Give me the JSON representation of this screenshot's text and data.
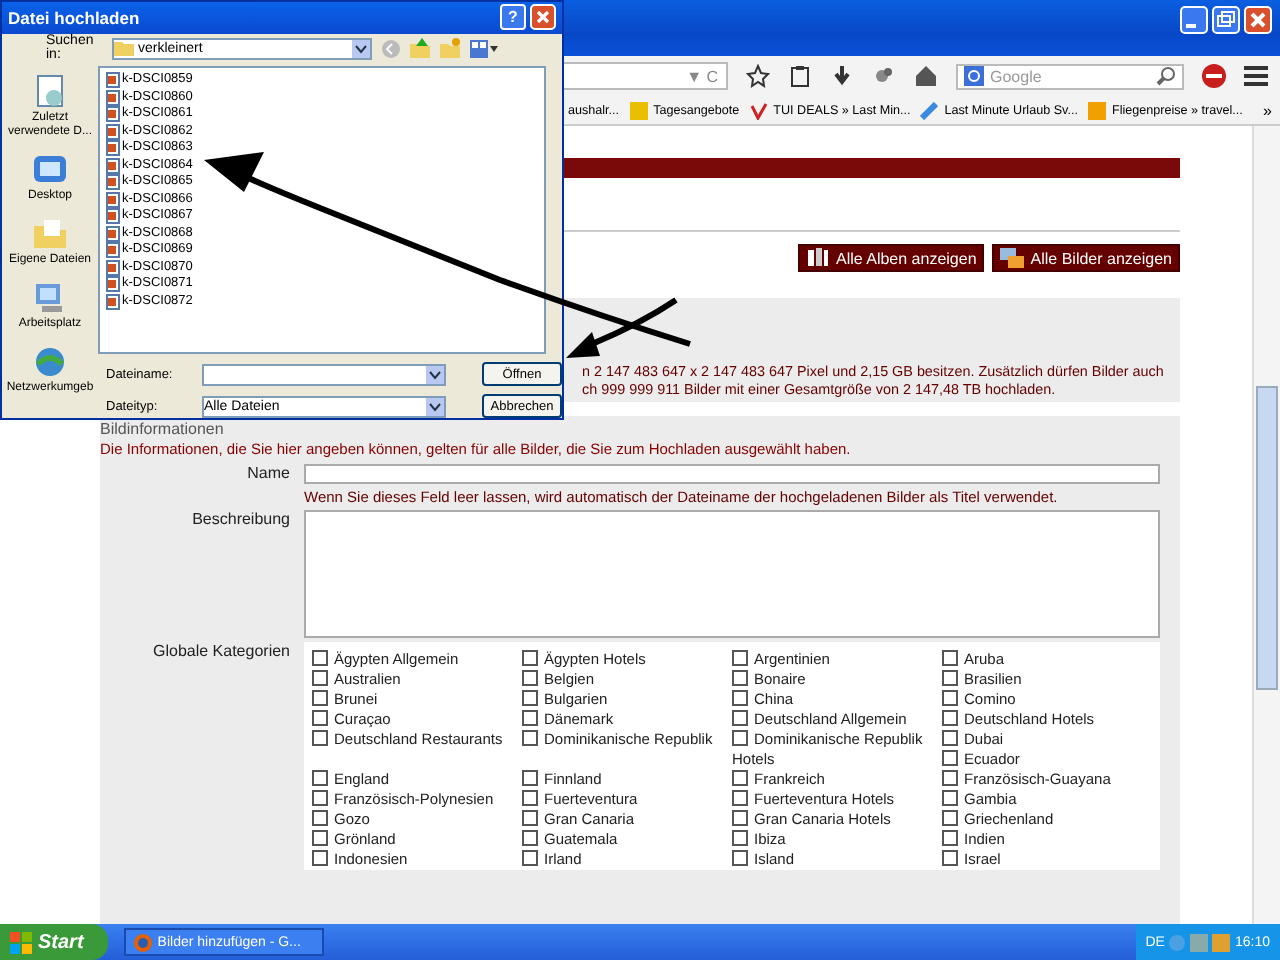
{
  "browser": {
    "url_icons": "▼ C",
    "search": {
      "placeholder": "Google"
    },
    "bookmarks": [
      {
        "label": "aushalr..."
      },
      {
        "label": "Tagesangebote"
      },
      {
        "label": "TUI DEALS » Last Min..."
      },
      {
        "label": "Last Minute Urlaub Sv..."
      },
      {
        "label": "Fliegenpreise » travel..."
      }
    ],
    "bookmarks_more": "»"
  },
  "page": {
    "buttons": [
      {
        "label": "Alle Alben anzeigen",
        "kind": "albums"
      },
      {
        "label": "Alle Bilder anzeigen",
        "kind": "images"
      }
    ],
    "limits_text": [
      "n 2 147 483 647 x 2 147 483 647 Pixel und 2,15 GB besitzen. Zusätzlich dürfen Bilder auch",
      "ch 999 999 911 Bilder mit einer Gesamtgröße von 2 147,48 TB hochladen."
    ],
    "section_title": "Bildinformationen",
    "section_intro": "Die Informationen, die Sie hier angeben können, gelten für alle Bilder, die Sie zum Hochladen ausgewählt haben.",
    "name_label": "Name",
    "name_hint": "Wenn Sie dieses Feld leer lassen, wird automatisch der Dateiname der hochgeladenen Bilder als Titel verwendet.",
    "description_label": "Beschreibung",
    "categories_label": "Globale Kategorien",
    "categories": [
      {
        "label": "Ägypten Allgemein",
        "checked": false
      },
      {
        "label": "Ägypten Hotels",
        "checked": false
      },
      {
        "label": "Argentinien",
        "checked": false
      },
      {
        "label": "Aruba",
        "checked": false
      },
      {
        "label": "Australien",
        "checked": false
      },
      {
        "label": "Belgien",
        "checked": false
      },
      {
        "label": "Bonaire",
        "checked": false
      },
      {
        "label": "Brasilien",
        "checked": false
      },
      {
        "label": "Brunei",
        "checked": false
      },
      {
        "label": "Bulgarien",
        "checked": false
      },
      {
        "label": "China",
        "checked": false
      },
      {
        "label": "Comino",
        "checked": false
      },
      {
        "label": "Curaçao",
        "checked": false
      },
      {
        "label": "Dänemark",
        "checked": false
      },
      {
        "label": "Deutschland Allgemein",
        "checked": false
      },
      {
        "label": "Deutschland Hotels",
        "checked": false
      },
      {
        "label": "Deutschland Restaurants",
        "checked": false
      },
      {
        "label": "Dominikanische Republik",
        "checked": false
      },
      {
        "label": "Dominikanische Republik Hotels",
        "checked": false
      },
      {
        "label": "Dubai",
        "checked": false
      },
      {
        "label": "Ecuador",
        "checked": false
      },
      {
        "label": "England",
        "checked": false
      },
      {
        "label": "Finnland",
        "checked": false
      },
      {
        "label": "Frankreich",
        "checked": false
      },
      {
        "label": "Französisch-Guayana",
        "checked": false
      },
      {
        "label": "Französisch-Polynesien",
        "checked": false
      },
      {
        "label": "Fuerteventura",
        "checked": false
      },
      {
        "label": "Fuerteventura Hotels",
        "checked": false
      },
      {
        "label": "Gambia",
        "checked": false
      },
      {
        "label": "Gozo",
        "checked": false
      },
      {
        "label": "Gran Canaria",
        "checked": false
      },
      {
        "label": "Gran Canaria Hotels",
        "checked": false
      },
      {
        "label": "Griechenland",
        "checked": false
      },
      {
        "label": "Grönland",
        "checked": false
      },
      {
        "label": "Guatemala",
        "checked": false
      },
      {
        "label": "Ibiza",
        "checked": false
      },
      {
        "label": "Indien",
        "checked": false
      },
      {
        "label": "Indonesien",
        "checked": false
      },
      {
        "label": "Irland",
        "checked": false
      },
      {
        "label": "Island",
        "checked": false
      },
      {
        "label": "Israel",
        "checked": false
      }
    ]
  },
  "dialog": {
    "title": "Datei hochladen",
    "help": "?",
    "look_in_label": "Suchen in:",
    "look_in_value": "verkleinert",
    "places": [
      {
        "label": "Zuletzt verwendete D...",
        "kind": "recent"
      },
      {
        "label": "Desktop",
        "kind": "desktop"
      },
      {
        "label": "Eigene Dateien",
        "kind": "documents"
      },
      {
        "label": "Arbeitsplatz",
        "kind": "computer"
      },
      {
        "label": "Netzwerkumgeb",
        "kind": "network"
      }
    ],
    "files": [
      "k-DSCI0859",
      "k-DSCI0860",
      "k-DSCI0861",
      "k-DSCI0862",
      "k-DSCI0863",
      "k-DSCI0864",
      "k-DSCI0865",
      "k-DSCI0866",
      "k-DSCI0867",
      "k-DSCI0868",
      "k-DSCI0869",
      "k-DSCI0870",
      "k-DSCI0871",
      "k-DSCI0872"
    ],
    "filename_label": "Dateiname:",
    "filetype_label": "Dateityp:",
    "filetype_value": "Alle Dateien",
    "buttons": [
      "Öffnen",
      "Abbrechen"
    ]
  },
  "taskbar": {
    "start": "Start",
    "tasks": [
      {
        "label": "Bilder hinzufügen - G...",
        "selected": false
      }
    ],
    "language": "DE",
    "clock": "16:10"
  }
}
